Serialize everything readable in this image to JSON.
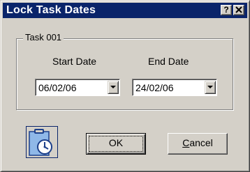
{
  "window": {
    "title": "Lock Task Dates",
    "help_label": "?",
    "close_label": "✕"
  },
  "task_group": {
    "label": "Task 001",
    "start_label": "Start Date",
    "end_label": "End Date",
    "start_value": "06/02/06",
    "end_value": "24/02/06"
  },
  "buttons": {
    "ok_label": "OK",
    "cancel_accel": "C",
    "cancel_rest": "ancel"
  },
  "icons": {
    "dialog_icon": "clipboard-clock-icon"
  },
  "colors": {
    "titlebar": "#0a246a",
    "face": "#d4d0c8"
  }
}
